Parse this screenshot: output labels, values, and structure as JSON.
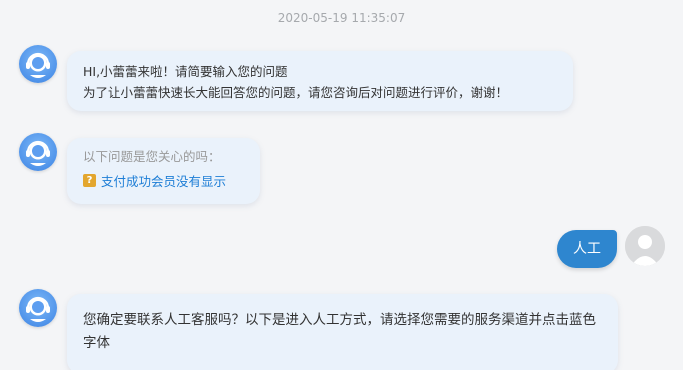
{
  "chat": {
    "timestamp": "2020-05-19 11:35:07",
    "messages": [
      {
        "sender": "bot",
        "lines": [
          "HI,小蕾蕾来啦！请简要输入您的问题",
          "为了让小蕾蕾快速长大能回答您的问题，请您咨询后对问题进行评价，谢谢！"
        ]
      },
      {
        "sender": "bot",
        "intro": "以下问题是您关心的吗：",
        "faq_icon": "question-icon",
        "faq_items": [
          "支付成功会员没有显示"
        ]
      },
      {
        "sender": "user",
        "text": "人工"
      },
      {
        "sender": "bot",
        "text": "您确定要联系人工客服吗？以下是进入人工方式，请选择您需要的服务渠道并点击蓝色字体"
      }
    ]
  },
  "colors": {
    "bot_bubble": "#eaf2fb",
    "user_bubble": "#2e86cf",
    "link": "#1e7ed6",
    "faq_icon": "#e3a62e",
    "background": "#f4f5f7"
  },
  "icons": {
    "bot_avatar": "support-agent-icon",
    "user_avatar": "user-avatar-icon"
  }
}
